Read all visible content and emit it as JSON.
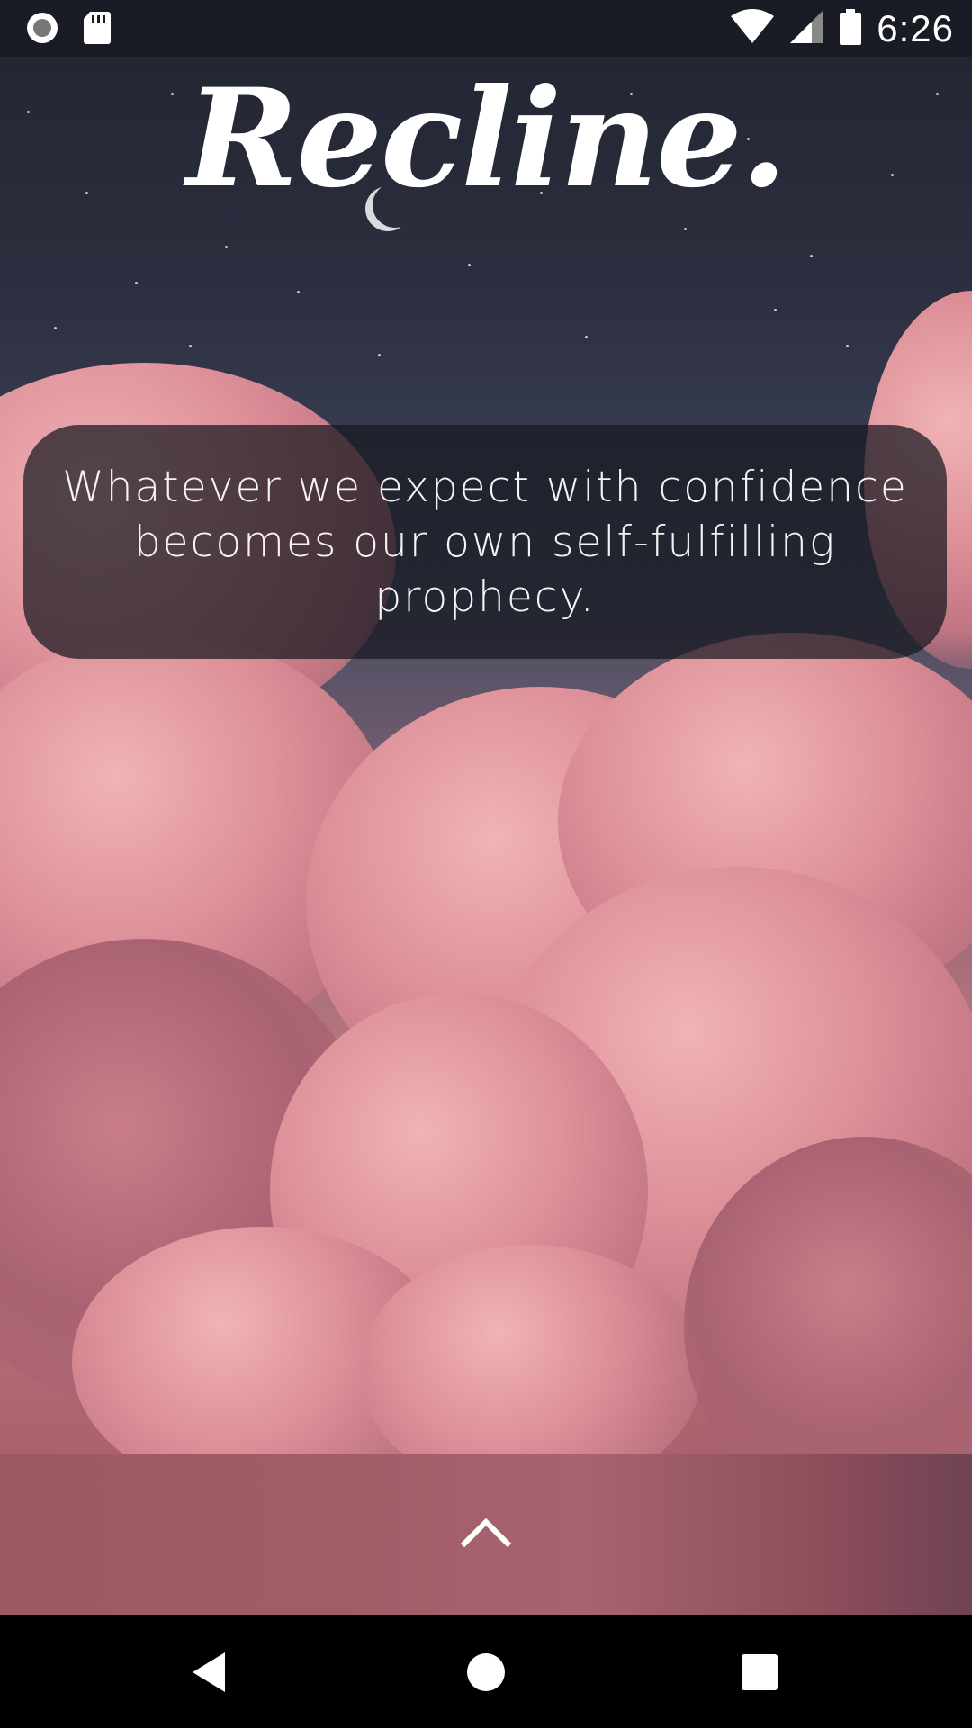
{
  "status_bar": {
    "time": "6:26",
    "left_icons": [
      "record-icon",
      "sd-card-icon"
    ],
    "right_icons": [
      "wifi-icon",
      "signal-icon",
      "battery-icon"
    ]
  },
  "app": {
    "title": "Recline."
  },
  "quote": {
    "text": "Whatever we expect with confidence becomes our own self-fulfilling prophecy."
  },
  "drawer": {
    "handle_icon": "chevron-up-icon"
  },
  "nav_bar": {
    "buttons": [
      "back-icon",
      "home-icon",
      "recents-icon"
    ]
  },
  "colors": {
    "quote_card_bg": "#161720",
    "drawer_bar": "#a25d69",
    "text": "#ffffff"
  }
}
